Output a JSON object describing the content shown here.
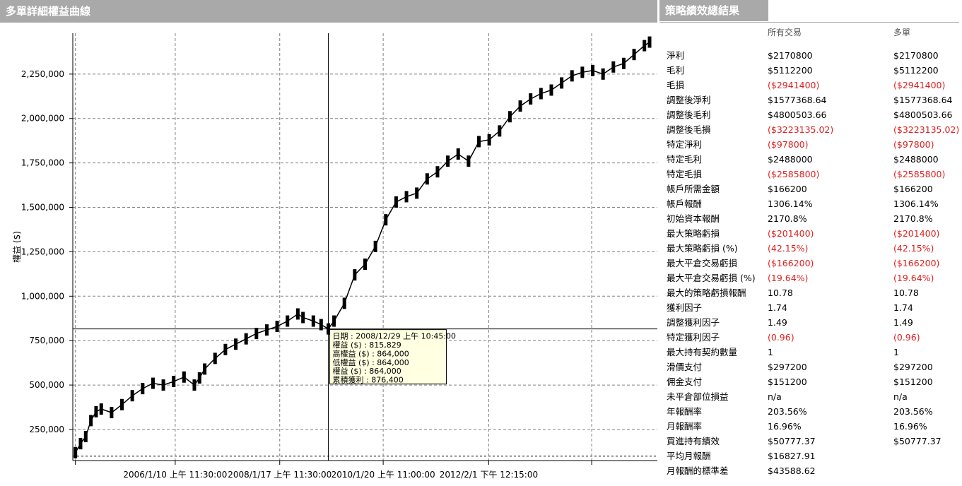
{
  "left_panel": {
    "title": "多單詳細權益曲線"
  },
  "right_panel": {
    "title": "策略績效總結果",
    "col_all": "所有交易",
    "col_long": "多單",
    "metrics": [
      {
        "label": "淨利",
        "all": "$2170800",
        "long": "$2170800",
        "negative": false
      },
      {
        "label": "毛利",
        "all": "$5112200",
        "long": "$5112200",
        "negative": false
      },
      {
        "label": "毛損",
        "all": "($2941400)",
        "long": "($2941400)",
        "negative": true
      },
      {
        "label": "調整後淨利",
        "all": "$1577368.64",
        "long": "$1577368.64",
        "negative": false
      },
      {
        "label": "調整後毛利",
        "all": "$4800503.66",
        "long": "$4800503.66",
        "negative": false
      },
      {
        "label": "調整後毛損",
        "all": "($3223135.02)",
        "long": "($3223135.02)",
        "negative": true
      },
      {
        "label": "特定淨利",
        "all": "($97800)",
        "long": "($97800)",
        "negative": true
      },
      {
        "label": "特定毛利",
        "all": "$2488000",
        "long": "$2488000",
        "negative": false
      },
      {
        "label": "特定毛損",
        "all": "($2585800)",
        "long": "($2585800)",
        "negative": true
      },
      {
        "label": "帳戶所需金額",
        "all": "$166200",
        "long": "$166200",
        "negative": false
      },
      {
        "label": "帳戶報酬",
        "all": "1306.14%",
        "long": "1306.14%",
        "negative": false
      },
      {
        "label": "初始資本報酬",
        "all": "2170.8%",
        "long": "2170.8%",
        "negative": false
      },
      {
        "label": "最大策略虧損",
        "all": "($201400)",
        "long": "($201400)",
        "negative": true
      },
      {
        "label": "最大策略虧損 (%)",
        "all": "(42.15%)",
        "long": "(42.15%)",
        "negative": true
      },
      {
        "label": "最大平倉交易虧損",
        "all": "($166200)",
        "long": "($166200)",
        "negative": true
      },
      {
        "label": "最大平倉交易虧損 (%)",
        "all": "(19.64%)",
        "long": "(19.64%)",
        "negative": true
      },
      {
        "label": "最大的策略虧損報酬",
        "all": "10.78",
        "long": "10.78",
        "negative": false
      },
      {
        "label": "獲利因子",
        "all": "1.74",
        "long": "1.74",
        "negative": false
      },
      {
        "label": "調整獲利因子",
        "all": "1.49",
        "long": "1.49",
        "negative": false
      },
      {
        "label": "特定獲利因子",
        "all": "(0.96)",
        "long": "(0.96)",
        "negative": true
      },
      {
        "label": "最大持有契約數量",
        "all": "1",
        "long": "1",
        "negative": false
      },
      {
        "label": "滑價支付",
        "all": "$297200",
        "long": "$297200",
        "negative": false
      },
      {
        "label": "佣金支付",
        "all": "$151200",
        "long": "$151200",
        "negative": false
      },
      {
        "label": "未平倉部位損益",
        "all": "n/a",
        "long": "n/a",
        "negative": false
      },
      {
        "label": "年報酬率",
        "all": "203.56%",
        "long": "203.56%",
        "negative": false
      },
      {
        "label": "月報酬率",
        "all": "16.96%",
        "long": "16.96%",
        "negative": false
      },
      {
        "label": "買進持有績效",
        "all": "$50777.37",
        "long": "$50777.37",
        "negative": false
      },
      {
        "label": "平均月報酬",
        "all": "$16827.91",
        "long": "",
        "negative": false
      },
      {
        "label": "月報酬的標準差",
        "all": "$43588.62",
        "long": "",
        "negative": false
      }
    ]
  },
  "colors": {
    "header_bg": "#a9a9a9",
    "negative": "#e02020",
    "tooltip_bg": "#ffffe1",
    "bar": "#000000"
  },
  "chart_data": {
    "type": "line",
    "ylabel": "權益 ($)",
    "ylim": [
      75000,
      2480000
    ],
    "yticks": [
      250000,
      500000,
      750000,
      1000000,
      1250000,
      1500000,
      1750000,
      2000000,
      2250000
    ],
    "ytick_labels": [
      "250,000",
      "500,000",
      "750,000",
      "1,000,000",
      "1,250,000",
      "1,500,000",
      "1,750,000",
      "2,000,000",
      "2,250,000"
    ],
    "xlim": [
      2004.05,
      2015.35
    ],
    "xtick_positions": [
      2004.1,
      2006.03,
      2008.05,
      2010.05,
      2012.09,
      2014.08
    ],
    "xtick_labels": [
      "",
      "2006/1/10 上午 11:30:00",
      "2008/1/17 上午 11:30:00",
      "2010/1/20 上午 11:00:00",
      "2012/2/1 下午 12:15:00",
      ""
    ],
    "grid": true,
    "crosshair": {
      "x": 2008.99,
      "y": 815829
    },
    "tooltip": {
      "lines": [
        "日期 : 2008/12/29 上午 10:45:00",
        "權益 ($) : 815,829",
        "高權益 ($) : 864,000",
        "低權益 ($) : 864,000",
        "權益 ($) : 864,000",
        "累積獲利 : 876,400"
      ]
    },
    "series": [
      {
        "x": [
          2004.1,
          2004.2,
          2004.3,
          2004.4,
          2004.5,
          2004.6,
          2004.8,
          2005.0,
          2005.2,
          2005.4,
          2005.6,
          2005.8,
          2006.0,
          2006.2,
          2006.4,
          2006.5,
          2006.6,
          2006.8,
          2007.0,
          2007.2,
          2007.4,
          2007.6,
          2007.8,
          2008.0,
          2008.2,
          2008.4,
          2008.5,
          2008.7,
          2008.85,
          2008.99,
          2009.1,
          2009.3,
          2009.5,
          2009.7,
          2009.9,
          2010.1,
          2010.3,
          2010.5,
          2010.7,
          2010.9,
          2011.1,
          2011.3,
          2011.5,
          2011.7,
          2011.9,
          2012.1,
          2012.3,
          2012.5,
          2012.7,
          2012.9,
          2013.1,
          2013.3,
          2013.5,
          2013.7,
          2013.9,
          2014.1,
          2014.3,
          2014.5,
          2014.7,
          2014.9,
          2015.1,
          2015.2
        ],
        "values": [
          120000,
          170000,
          210000,
          300000,
          350000,
          365000,
          345000,
          390000,
          440000,
          480000,
          510000,
          500000,
          520000,
          545000,
          500000,
          540000,
          590000,
          650000,
          700000,
          730000,
          760000,
          790000,
          810000,
          830000,
          860000,
          900000,
          880000,
          860000,
          840000,
          815829,
          860000,
          960000,
          1120000,
          1180000,
          1280000,
          1430000,
          1530000,
          1560000,
          1580000,
          1660000,
          1700000,
          1760000,
          1800000,
          1760000,
          1870000,
          1880000,
          1930000,
          2010000,
          2070000,
          2110000,
          2140000,
          2160000,
          2200000,
          2240000,
          2260000,
          2270000,
          2250000,
          2290000,
          2310000,
          2360000,
          2410000,
          2430000
        ]
      }
    ]
  }
}
